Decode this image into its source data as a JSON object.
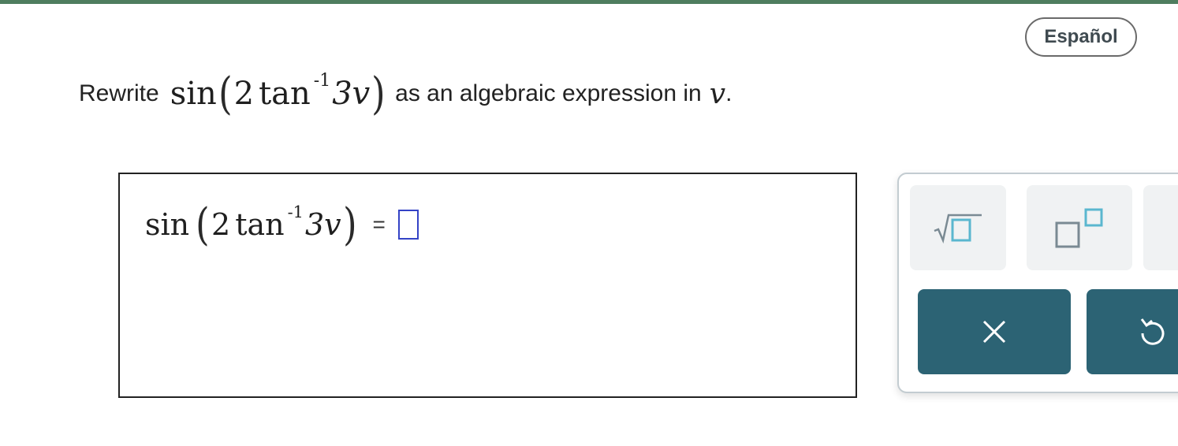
{
  "language_button": {
    "label": "Español"
  },
  "question": {
    "prefix": "Rewrite",
    "expression": {
      "func": "sin",
      "coef": "2",
      "inner_func": "tan",
      "exponent": "-1",
      "argument": "3v"
    },
    "suffix": "as an algebraic expression in",
    "variable": "v",
    "end": "."
  },
  "answer": {
    "lhs": {
      "func": "sin",
      "coef": "2",
      "inner_func": "tan",
      "exponent": "-1",
      "argument": "3v"
    },
    "equals": "=",
    "value": ""
  },
  "tools": {
    "buttons": [
      "square-root",
      "exponent"
    ],
    "actions": [
      "clear",
      "undo"
    ]
  },
  "colors": {
    "top_bar": "#4f7d5f",
    "action_button": "#2c6374",
    "input_slot_border": "#3443c6",
    "tool_icon": "#7a8a93",
    "tool_icon_highlight": "#5ab7cf"
  }
}
